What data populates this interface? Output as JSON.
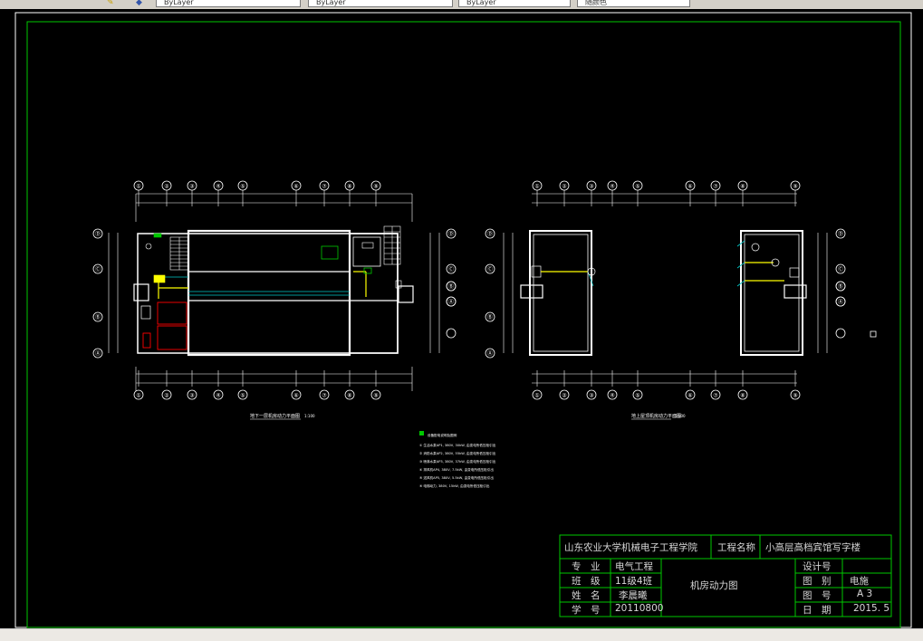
{
  "toolbar": {
    "dropdowns": [
      {
        "name": "layer-dropdown",
        "value": "ByLayer"
      },
      {
        "name": "linetype-dropdown",
        "value": "ByLayer"
      },
      {
        "name": "lineweight-dropdown",
        "value": "ByLayer"
      },
      {
        "name": "plotstyle-dropdown",
        "value": "随颜色"
      }
    ],
    "icons": [
      "layer-properties-icon",
      "layer-previous-icon"
    ]
  },
  "title_block": {
    "school": "山东农业大学机械电子工程学院",
    "project_label": "工程名称",
    "project_name": "小高层高档宾馆写字楼",
    "drawing_name": "机房动力图",
    "left_rows": [
      {
        "label": "专　业",
        "value": "电气工程"
      },
      {
        "label": "班　级",
        "value": "11级4班"
      },
      {
        "label": "姓　名",
        "value": "李晨曦"
      },
      {
        "label": "学　号",
        "value": "20110800"
      }
    ],
    "right_rows": [
      {
        "label": "设计号",
        "value": ""
      },
      {
        "label": "图　别",
        "value": "电施"
      },
      {
        "label": "图　号",
        "value": "A 3"
      },
      {
        "label": "日　期",
        "value": "2015. 5"
      }
    ]
  },
  "plans": {
    "left_axes_top": [
      "①",
      "②",
      "③",
      "④",
      "⑤",
      "⑥",
      "⑦",
      "⑧",
      "⑨"
    ],
    "left_axes_bottom": [
      "①",
      "②",
      "③",
      "④",
      "⑤",
      "⑥",
      "⑦",
      "⑧",
      "⑨"
    ],
    "right_axes_top": [
      "①",
      "②",
      "③",
      "④",
      "⑤",
      "⑥",
      "⑦",
      "⑧",
      "⑨"
    ],
    "right_axes_bottom": [
      "①",
      "②",
      "③",
      "④",
      "⑤",
      "⑥",
      "⑦",
      "⑧",
      "⑨"
    ],
    "row_axes": [
      "Ⓓ",
      "Ⓒ",
      "Ⓑ",
      "Ⓐ"
    ],
    "row_axes_side": [
      "Ⓓ",
      "Ⓒ",
      "Ⓑ",
      "Ⓐ"
    ],
    "left_caption": "地下一层机房动力平面图",
    "left_scale": "1:100",
    "right_caption": "地上屋顶机房动力平面图",
    "right_scale": "1:100"
  },
  "legend": {
    "title": "设备配电说明及图例",
    "items": [
      "① 生活水泵AP1, 380V, 30kW, 由变电所低压柜引出",
      "② 消防水泵AP2, 380V, 55kW, 由变电所低压柜引出",
      "③ 喷淋水泵AP3, 380V, 37kW, 由变电所低压柜引出",
      "④ 排风机AP4, 380V, 7.5kW, 由变电所低压柜引出",
      "⑤ 送风机AP5, 380V, 5.5kW, 由变电所低压柜引出",
      "⑥ 电梯动力, 380V, 15kW, 由变电所低压柜引出"
    ]
  },
  "colors": {
    "frame": "#00c800",
    "wall": "#ffffff",
    "cable": "#ffff00",
    "dim": "#ffffff",
    "equipment": "#ff0000"
  }
}
